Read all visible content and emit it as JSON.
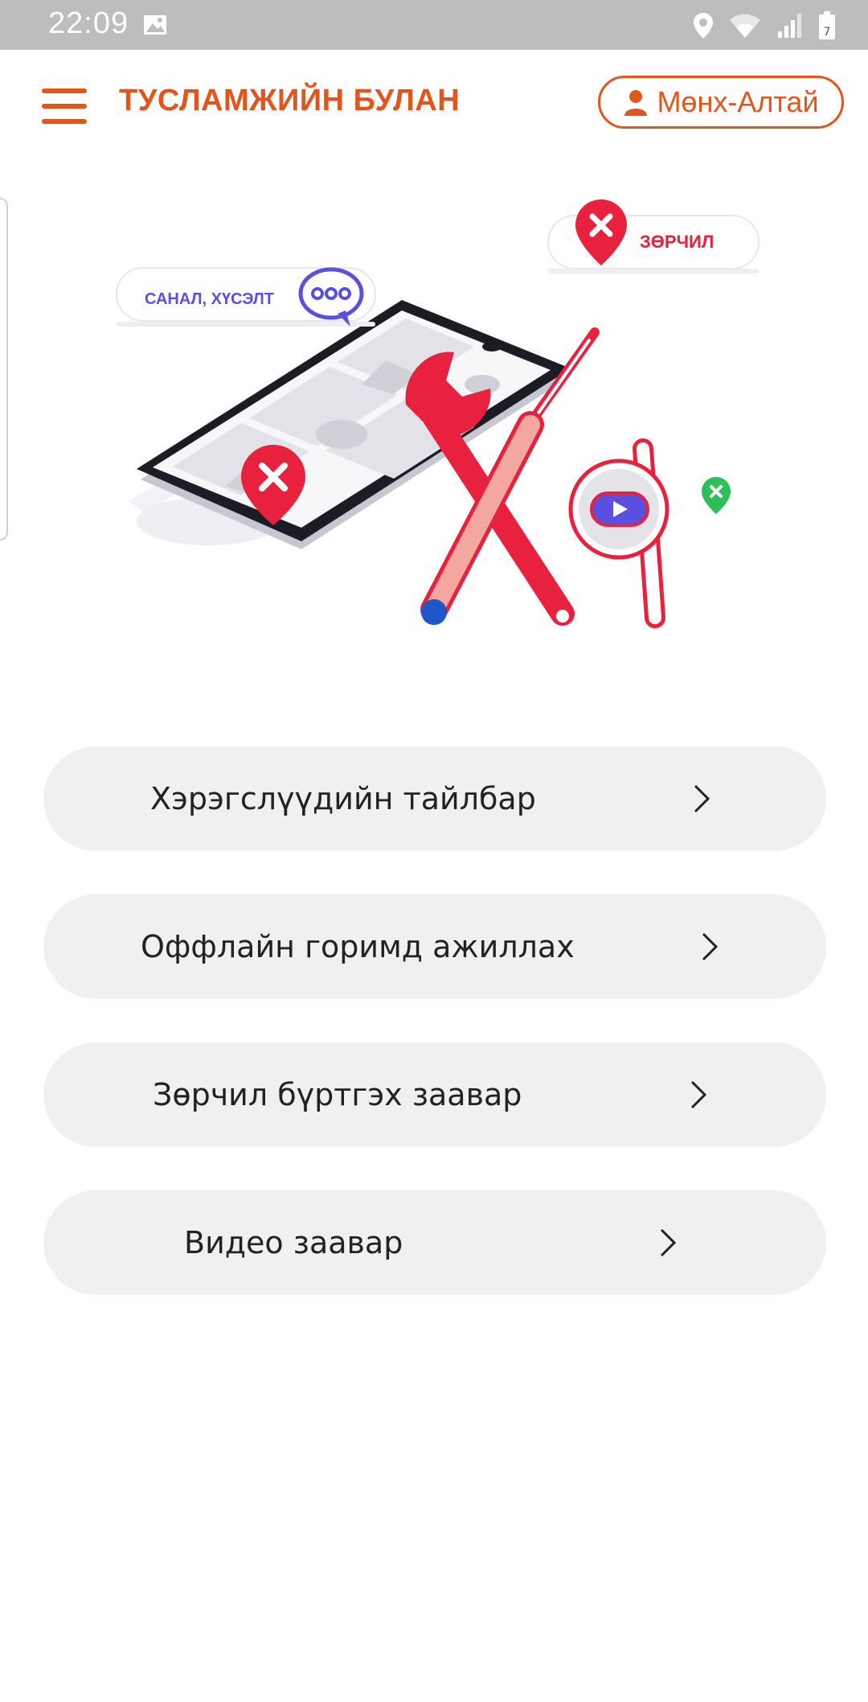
{
  "status_bar": {
    "time": "22:09",
    "icons": [
      "image-icon",
      "location-icon",
      "wifi-icon",
      "signal-icon",
      "battery-icon"
    ]
  },
  "header": {
    "title": "ТУСЛАМЖИЙН БУЛАН",
    "user_label": "Мөнх-Алтай"
  },
  "illustration": {
    "feedback_label": "САНАЛ, ХҮСЭЛТ",
    "violation_label": "ЗӨРЧИЛ"
  },
  "menu": {
    "items": [
      {
        "label": "Хэрэгслүүдийн тайлбар"
      },
      {
        "label": "Оффлайн горимд ажиллах"
      },
      {
        "label": "Зөрчил бүртгэх заавар"
      },
      {
        "label": "Видео заавар"
      }
    ]
  },
  "colors": {
    "accent": "#e0561c",
    "violation_red": "#e8213f",
    "feedback_blue": "#5b4fe0",
    "item_bg": "#f0f0f2",
    "status_bar": "#bdbdbd"
  }
}
